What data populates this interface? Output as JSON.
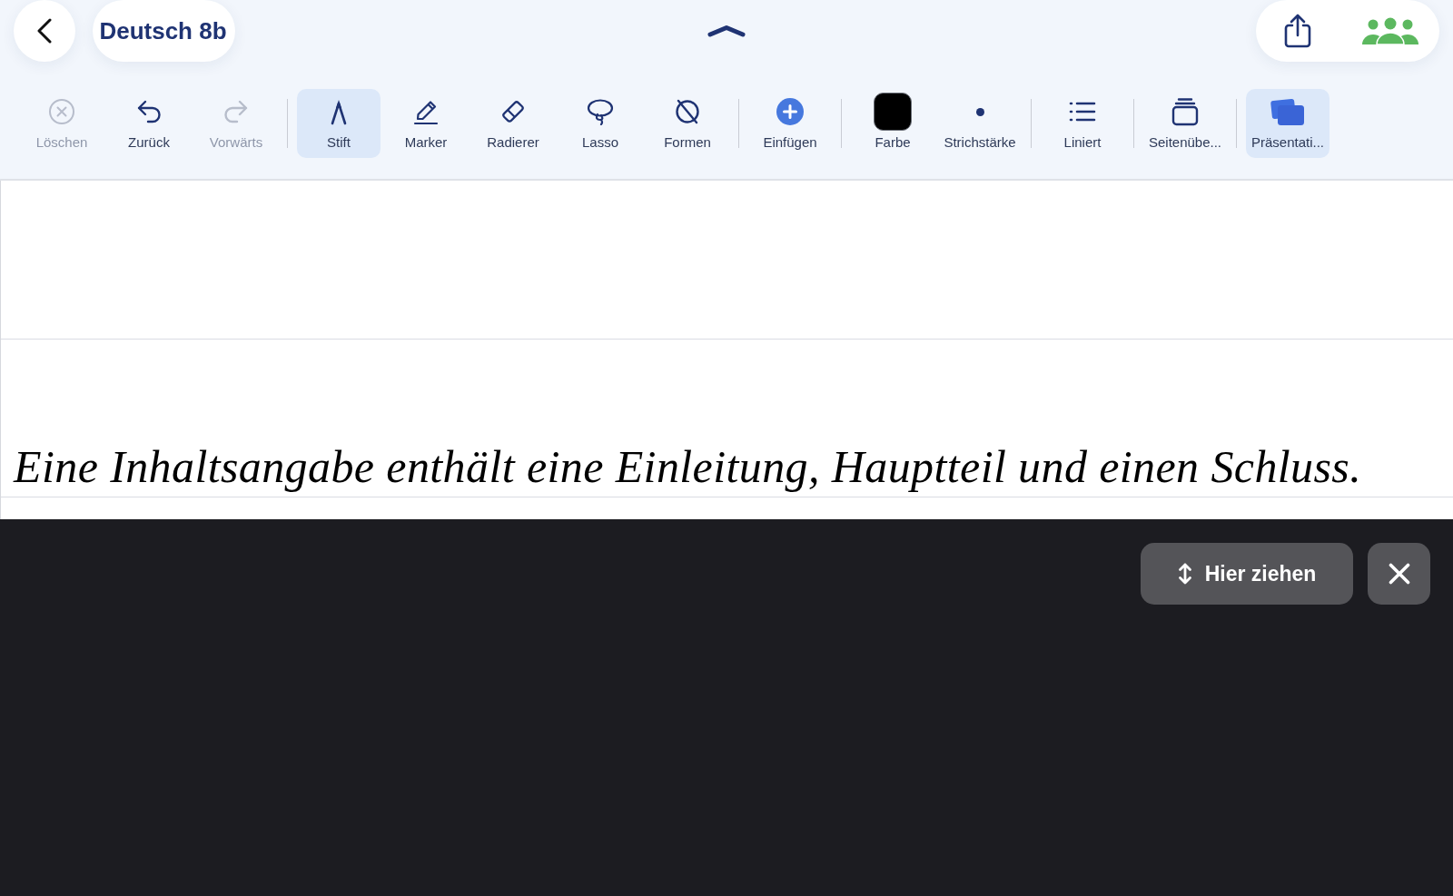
{
  "header": {
    "title": "Deutsch 8b"
  },
  "toolbar": {
    "groups": [
      {
        "items": [
          {
            "kind": "delete",
            "label": "Löschen",
            "selected": false,
            "disabled": true
          },
          {
            "kind": "undo",
            "label": "Zurück",
            "selected": false,
            "disabled": false
          },
          {
            "kind": "redo",
            "label": "Vorwärts",
            "selected": false,
            "disabled": true
          }
        ]
      },
      {
        "items": [
          {
            "kind": "pen",
            "label": "Stift",
            "selected": true,
            "disabled": false
          },
          {
            "kind": "marker",
            "label": "Marker",
            "selected": false,
            "disabled": false
          },
          {
            "kind": "eraser",
            "label": "Radierer",
            "selected": false,
            "disabled": false
          },
          {
            "kind": "lasso",
            "label": "Lasso",
            "selected": false,
            "disabled": false
          },
          {
            "kind": "shapes",
            "label": "Formen",
            "selected": false,
            "disabled": false
          }
        ]
      },
      {
        "items": [
          {
            "kind": "insert",
            "label": "Einfügen",
            "selected": false,
            "disabled": false
          }
        ]
      },
      {
        "items": [
          {
            "kind": "color",
            "label": "Farbe",
            "selected": false,
            "disabled": false,
            "color": "#000000"
          },
          {
            "kind": "stroke",
            "label": "Strichstärke",
            "selected": false,
            "disabled": false
          }
        ]
      },
      {
        "items": [
          {
            "kind": "lined",
            "label": "Liniert",
            "selected": false,
            "disabled": false
          }
        ]
      },
      {
        "items": [
          {
            "kind": "pages",
            "label": "Seitenübe...",
            "selected": false,
            "disabled": false
          }
        ]
      },
      {
        "items": [
          {
            "kind": "presentation",
            "label": "Präsentati...",
            "selected": true,
            "disabled": false
          }
        ]
      }
    ]
  },
  "canvas": {
    "handwriting": "Eine Inhaltsangabe enthält eine Einleitung, Hauptteil und einen Schluss."
  },
  "drag_panel": {
    "drag_button": "Hier ziehen"
  }
}
